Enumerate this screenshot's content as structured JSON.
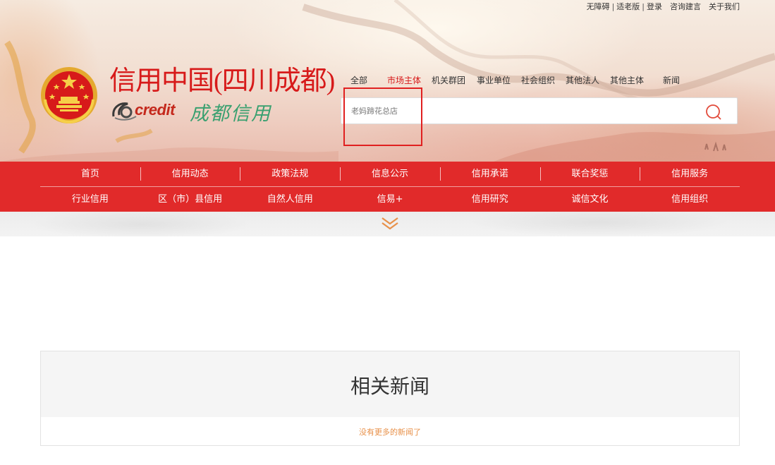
{
  "toplinks": {
    "accessibility": "无障碍",
    "elderly": "适老版",
    "login": "登录",
    "consult": "咨询建言",
    "about": "关于我们"
  },
  "site": {
    "title": "信用中国(四川成都)",
    "logo_credit": "credit",
    "logo_calligraphy": "成都信用"
  },
  "search": {
    "tabs": [
      "全部",
      "市场主体",
      "机关群团",
      "事业单位",
      "社会组织",
      "其他法人",
      "其他主体",
      "新闻"
    ],
    "active_tab": "市场主体",
    "value": "老妈蹄花总店"
  },
  "nav": {
    "row1": [
      "首页",
      "信用动态",
      "政策法规",
      "信息公示",
      "信用承诺",
      "联合奖惩",
      "信用服务"
    ],
    "row2": [
      "行业信用",
      "区（市）县信用",
      "自然人信用",
      "信易+",
      "信用研究",
      "诚信文化",
      "信用组织"
    ]
  },
  "news": {
    "title": "相关新闻",
    "empty_text": "没有更多的新闻了"
  },
  "colors": {
    "brand_red": "#e12a2a",
    "title_red": "#d71a1a",
    "empty_orange": "#e8914a",
    "highlight_red": "#e02020"
  }
}
